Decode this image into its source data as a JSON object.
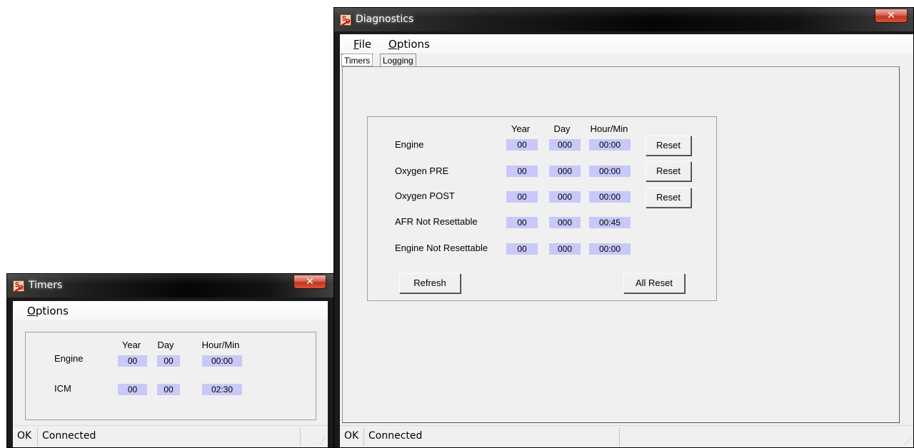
{
  "timers_window": {
    "title": "Timers",
    "menu": {
      "options": "Options"
    },
    "headers": {
      "year": "Year",
      "day": "Day",
      "hour_min": "Hour/Min"
    },
    "rows": [
      {
        "label": "Engine",
        "year": "00",
        "day": "00",
        "hour_min": "00:00"
      },
      {
        "label": "ICM",
        "year": "00",
        "day": "00",
        "hour_min": "02:30"
      }
    ],
    "status": {
      "state": "OK",
      "connection": "Connected"
    }
  },
  "diag_window": {
    "title": "Diagnostics",
    "menu": {
      "file": "File",
      "options": "Options"
    },
    "tabs": [
      {
        "label": "Timers"
      },
      {
        "label": "Logging"
      }
    ],
    "headers": {
      "year": "Year",
      "day": "Day",
      "hour_min": "Hour/Min"
    },
    "rows": [
      {
        "label": "Engine",
        "year": "00",
        "day": "000",
        "hour_min": "00:00",
        "reset": "Reset"
      },
      {
        "label": "Oxygen PRE",
        "year": "00",
        "day": "000",
        "hour_min": "00:00",
        "reset": "Reset"
      },
      {
        "label": "Oxygen POST",
        "year": "00",
        "day": "000",
        "hour_min": "00:00",
        "reset": "Reset"
      },
      {
        "label": "AFR Not Resettable",
        "year": "00",
        "day": "000",
        "hour_min": "00:45"
      },
      {
        "label": "Engine Not Resettable",
        "year": "00",
        "day": "000",
        "hour_min": "00:00"
      }
    ],
    "buttons": {
      "refresh": "Refresh",
      "all_reset": "All Reset"
    },
    "status": {
      "state": "OK",
      "connection": "Connected"
    }
  },
  "icons": {
    "app": "app-logo-icon",
    "close": "close-icon",
    "grip": "resize-grip-icon"
  },
  "colors": {
    "value_bg": "#c8c8fa",
    "close_button": "#c1331b",
    "titlebar": "#050505"
  }
}
